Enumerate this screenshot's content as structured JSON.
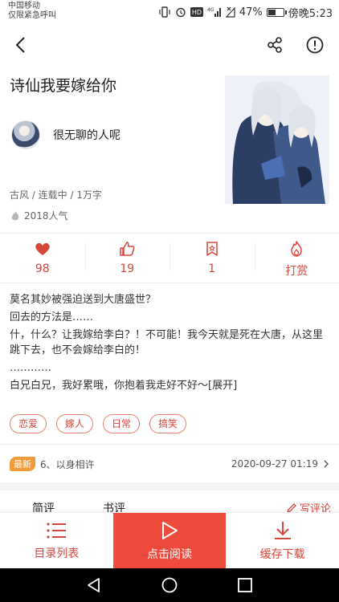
{
  "status_bar": {
    "carrier_line1": "中国移动",
    "carrier_line2": "仅限紧急呼叫",
    "battery_percent": "47%",
    "battery_level": 0.47,
    "time": "傍晚5:23"
  },
  "book": {
    "title": "诗仙我要嫁给你",
    "author": "很无聊的人呢",
    "meta": "古风 / 连载中 / 1万字",
    "popularity": "2018人气"
  },
  "stats": [
    {
      "label": "98",
      "icon": "heart-icon"
    },
    {
      "label": "19",
      "icon": "thumbs-up-icon"
    },
    {
      "label": "1",
      "icon": "bookmark-icon"
    },
    {
      "label": "打赏",
      "icon": "flame-icon"
    }
  ],
  "intro": {
    "line1": "莫名其妙被强迫送到大唐盛世？",
    "line2": "回去的方法是……",
    "line3": "什，什么？让我嫁给李白？！不可能！我今天就是死在大唐，从这里跳下去，也不会嫁给李白的！",
    "line4": "…………",
    "line5": "白兄白兄，我好累哦，你抱着我走好不好～",
    "expand": "[展开]"
  },
  "tags": [
    "恋爱",
    "嫁人",
    "日常",
    "搞笑"
  ],
  "latest": {
    "badge": "最新",
    "chapter": "6、以身相许",
    "date": "2020-09-27 01:19"
  },
  "tabs": {
    "brief_review": "简评",
    "book_review": "书评",
    "write_review": "写评论"
  },
  "bottom_bar": {
    "catalog": "目录列表",
    "read": "点击阅读",
    "download": "缓存下载"
  },
  "colors": {
    "accent": "#d6463b",
    "primary_button": "#ef4b3d",
    "latest_badge": "#f29b3b"
  }
}
